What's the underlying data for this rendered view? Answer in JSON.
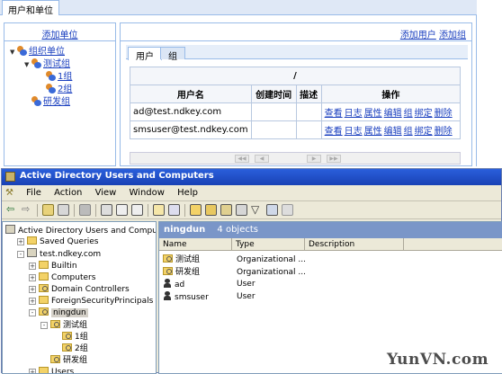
{
  "web": {
    "tab_label": "用户和单位",
    "add_unit_link": "添加单位",
    "add_user_link": "添加用户",
    "add_group_link": "添加组",
    "tree": [
      {
        "label": "组织单位",
        "level": 0
      },
      {
        "label": "测试组",
        "level": 1
      },
      {
        "label": "1组",
        "level": 2
      },
      {
        "label": "2组",
        "level": 2
      },
      {
        "label": "研发组",
        "level": 1
      }
    ],
    "inner_tabs": [
      "用户",
      "组"
    ],
    "grid": {
      "path": "/",
      "headers": [
        "用户名",
        "创建时间",
        "描述",
        "操作"
      ],
      "rows": [
        {
          "name": "ad@test.ndkey.com",
          "created": "",
          "desc": ""
        },
        {
          "name": "smsuser@test.ndkey.com",
          "created": "",
          "desc": ""
        }
      ],
      "ops": [
        "查看",
        "日志",
        "属性",
        "编辑",
        "组",
        "绑定",
        "删除"
      ]
    }
  },
  "aduc": {
    "title": "Active Directory Users and Computers",
    "menu": [
      "File",
      "Action",
      "View",
      "Window",
      "Help"
    ],
    "tree": [
      {
        "label": "Active Directory Users and Computer",
        "indent": 0,
        "type": "root"
      },
      {
        "label": "Saved Queries",
        "indent": 1,
        "type": "folder",
        "pm": "+"
      },
      {
        "label": "test.ndkey.com",
        "indent": 1,
        "type": "domain",
        "pm": "-"
      },
      {
        "label": "Builtin",
        "indent": 2,
        "type": "folder",
        "pm": "+"
      },
      {
        "label": "Computers",
        "indent": 2,
        "type": "folder",
        "pm": "+"
      },
      {
        "label": "Domain Controllers",
        "indent": 2,
        "type": "ou",
        "pm": "+"
      },
      {
        "label": "ForeignSecurityPrincipals",
        "indent": 2,
        "type": "folder",
        "pm": "+"
      },
      {
        "label": "ningdun",
        "indent": 2,
        "type": "ou",
        "pm": "-",
        "selected": true
      },
      {
        "label": "测试组",
        "indent": 3,
        "type": "ou",
        "pm": "-"
      },
      {
        "label": "1组",
        "indent": 4,
        "type": "ou",
        "pm": ""
      },
      {
        "label": "2组",
        "indent": 4,
        "type": "ou",
        "pm": ""
      },
      {
        "label": "研发组",
        "indent": 3,
        "type": "ou",
        "pm": ""
      },
      {
        "label": "Users",
        "indent": 2,
        "type": "folder",
        "pm": "+"
      }
    ],
    "list_header": {
      "title": "ningdun",
      "count": "4 objects"
    },
    "columns": [
      "Name",
      "Type",
      "Description"
    ],
    "rows": [
      {
        "name": "测试组",
        "type": "Organizational ...",
        "icon": "ou"
      },
      {
        "name": "研发组",
        "type": "Organizational ...",
        "icon": "ou"
      },
      {
        "name": "ad",
        "type": "User",
        "icon": "user"
      },
      {
        "name": "smsuser",
        "type": "User",
        "icon": "user"
      }
    ]
  },
  "watermark": "YunVN.com"
}
